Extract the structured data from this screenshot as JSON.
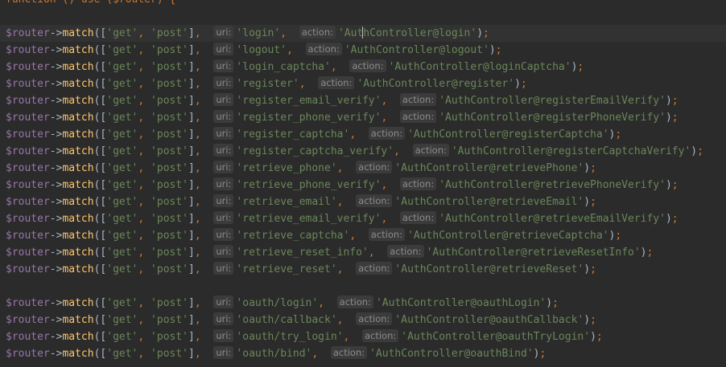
{
  "editor": {
    "header_line": "function () use ($router) {",
    "hint_labels": {
      "uri": "uri:",
      "action": "action:"
    },
    "methods": [
      "'get'",
      "'post'"
    ],
    "route_var": "$router",
    "route_op": "->",
    "route_fn": "match",
    "routes_group1": [
      {
        "uri": "'login'",
        "action": "'AuthController@login'"
      },
      {
        "uri": "'logout'",
        "action": "'AuthController@logout'"
      },
      {
        "uri": "'login_captcha'",
        "action": "'AuthController@loginCaptcha'"
      },
      {
        "uri": "'register'",
        "action": "'AuthController@register'"
      },
      {
        "uri": "'register_email_verify'",
        "action": "'AuthController@registerEmailVerify'"
      },
      {
        "uri": "'register_phone_verify'",
        "action": "'AuthController@registerPhoneVerify'"
      },
      {
        "uri": "'register_captcha'",
        "action": "'AuthController@registerCaptcha'"
      },
      {
        "uri": "'register_captcha_verify'",
        "action": "'AuthController@registerCaptchaVerify'"
      },
      {
        "uri": "'retrieve_phone'",
        "action": "'AuthController@retrievePhone'"
      },
      {
        "uri": "'retrieve_phone_verify'",
        "action": "'AuthController@retrievePhoneVerify'"
      },
      {
        "uri": "'retrieve_email'",
        "action": "'AuthController@retrieveEmail'"
      },
      {
        "uri": "'retrieve_email_verify'",
        "action": "'AuthController@retrieveEmailVerify'"
      },
      {
        "uri": "'retrieve_captcha'",
        "action": "'AuthController@retrieveCaptcha'"
      },
      {
        "uri": "'retrieve_reset_info'",
        "action": "'AuthController@retrieveResetInfo'"
      },
      {
        "uri": "'retrieve_reset'",
        "action": "'AuthController@retrieveReset'"
      }
    ],
    "routes_group2": [
      {
        "uri": "'oauth/login'",
        "action": "'AuthController@oauthLogin'"
      },
      {
        "uri": "'oauth/callback'",
        "action": "'AuthController@oauthCallback'"
      },
      {
        "uri": "'oauth/try_login'",
        "action": "'AuthController@oauthTryLogin'"
      },
      {
        "uri": "'oauth/bind'",
        "action": "'AuthController@oauthBind'"
      }
    ],
    "colors": {
      "background": "#2b2b2b",
      "current_line": "#323232",
      "variable": "#9876aa",
      "function": "#ffc66d",
      "string": "#6a8759",
      "keyword": "#cc7832",
      "hint_bg": "#3b3b3b",
      "hint_text": "#8c8c8c"
    }
  }
}
